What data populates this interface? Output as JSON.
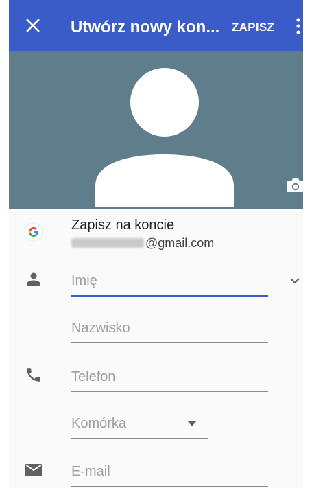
{
  "appbar": {
    "title": "Utwórz nowy kon...",
    "save_label": "ZAPISZ",
    "icons": [
      "close-icon",
      "more-vert-icon"
    ],
    "color": "#3a5cc8"
  },
  "photo": {
    "background": "#607d8b",
    "icons": [
      "person-silhouette",
      "camera-icon"
    ]
  },
  "account": {
    "label": "Zapisz na koncie",
    "email_domain": "@gmail.com",
    "icon": "google-g-icon"
  },
  "fields": {
    "first_name_placeholder": "Imię",
    "last_name_placeholder": "Nazwisko",
    "phone_placeholder": "Telefon",
    "phone_type": "Komórka",
    "email_placeholder": "E-mail"
  },
  "icons": [
    "person-icon",
    "phone-icon",
    "email-icon",
    "chevron-down-icon",
    "dropdown-arrow-icon"
  ]
}
